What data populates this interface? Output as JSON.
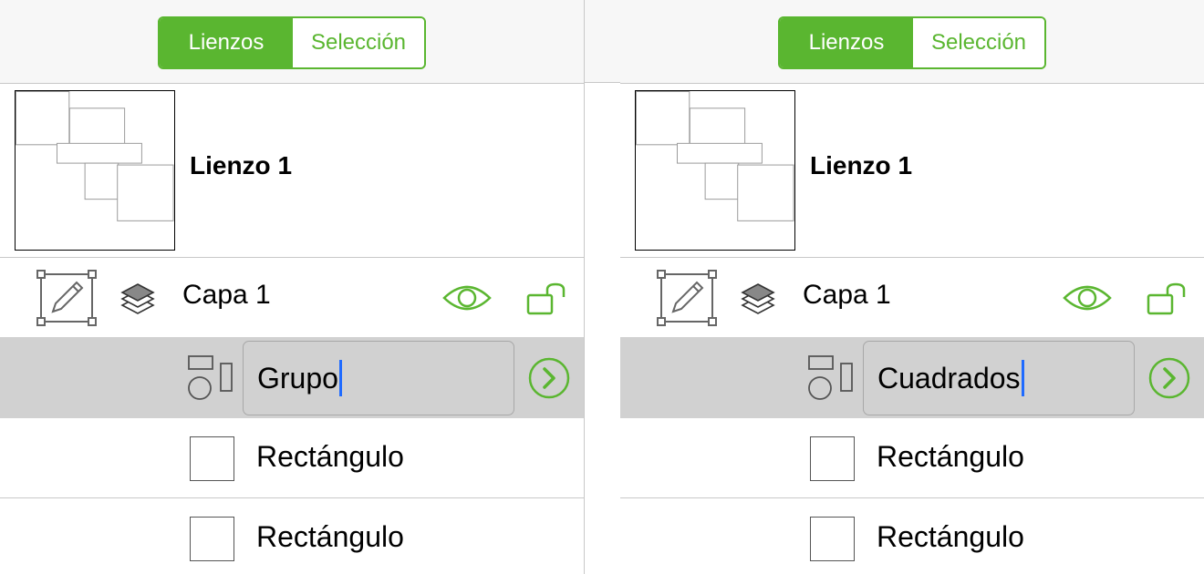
{
  "colors": {
    "accent": "#5ab630",
    "selected_row_bg": "#d1d1d1",
    "caret": "#1f6bff",
    "divider": "#c8c8c8"
  },
  "panels": [
    {
      "tabs": {
        "canvases": "Lienzos",
        "selection": "Selección",
        "active": "canvases"
      },
      "canvas": {
        "name": "Lienzo 1"
      },
      "layer": {
        "name": "Capa 1",
        "icons": [
          "edit-layer-icon",
          "layers-icon",
          "eye-icon",
          "unlock-icon"
        ]
      },
      "group": {
        "name_field_value": "Grupo",
        "icon": "group-shapes-icon"
      },
      "shapes": [
        {
          "name": "Rectángulo",
          "icon": "rectangle-icon"
        },
        {
          "name": "Rectángulo",
          "icon": "rectangle-icon"
        }
      ]
    },
    {
      "tabs": {
        "canvases": "Lienzos",
        "selection": "Selección",
        "active": "canvases"
      },
      "canvas": {
        "name": "Lienzo 1"
      },
      "layer": {
        "name": "Capa 1",
        "icons": [
          "edit-layer-icon",
          "layers-icon",
          "eye-icon",
          "unlock-icon"
        ]
      },
      "group": {
        "name_field_value": "Cuadrados",
        "icon": "group-shapes-icon"
      },
      "shapes": [
        {
          "name": "Rectángulo",
          "icon": "rectangle-icon"
        },
        {
          "name": "Rectángulo",
          "icon": "rectangle-icon"
        }
      ]
    }
  ]
}
